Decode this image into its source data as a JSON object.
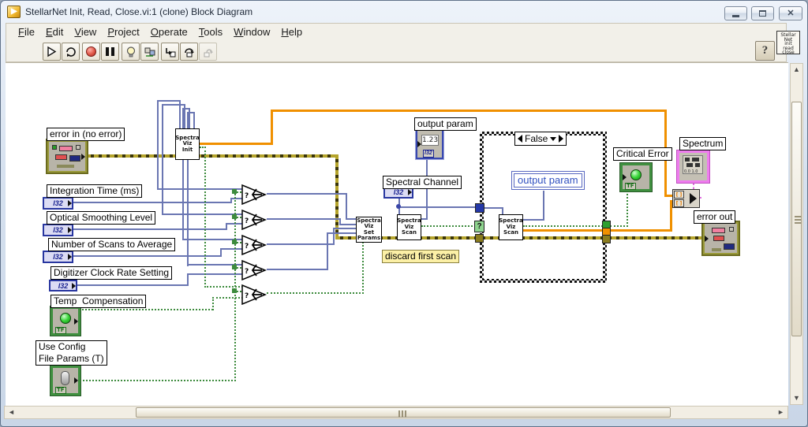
{
  "window": {
    "title": "StellarNet Init, Read, Close.vi:1 (clone) Block Diagram"
  },
  "menu": {
    "items": [
      "File",
      "Edit",
      "View",
      "Project",
      "Operate",
      "Tools",
      "Window",
      "Help"
    ]
  },
  "toolbar": {
    "help": "?",
    "vi_icon": [
      "Stellar",
      "Net",
      "init",
      "read",
      "close"
    ]
  },
  "diagram": {
    "labels": {
      "error_in": "error in (no error)",
      "integration_time": "Integration Time (ms)",
      "optical_smoothing": "Optical Smoothing Level",
      "num_scans": "Number of Scans to Average",
      "digitizer": "Digitizer Clock Rate Setting",
      "temp_comp": "Temp  Compensation",
      "use_config": "Use Config\nFile Params (T)",
      "output_param": "output param",
      "spectral_channel": "Spectral Channel",
      "discard": "discard first scan",
      "case_selector": "False",
      "output_param_local": "output param",
      "critical_error": "Critical Error",
      "spectrum": "Spectrum",
      "error_out": "error out"
    },
    "subvis": {
      "init": [
        "Spectra",
        "Viz",
        "Init"
      ],
      "set_params": [
        "Spectra",
        "Viz",
        "Set",
        "Params"
      ],
      "scan": [
        "Spectra",
        "Viz",
        "Scan"
      ]
    },
    "terminals": {
      "i32": "I32",
      "tf": "TF",
      "indicator_value": "1.23",
      "spectrum_axis": "0.0  1.0"
    }
  }
}
